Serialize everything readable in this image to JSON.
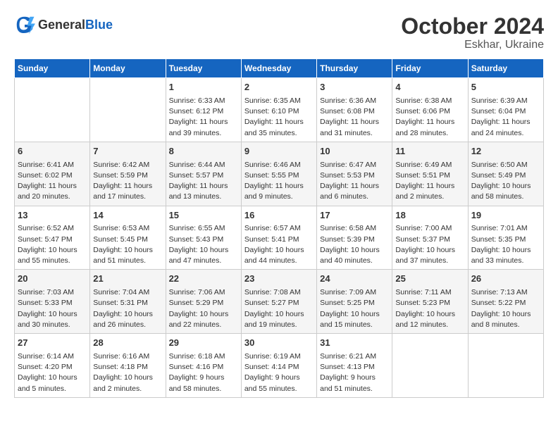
{
  "header": {
    "logo_general": "General",
    "logo_blue": "Blue",
    "month": "October 2024",
    "location": "Eskhar, Ukraine"
  },
  "weekdays": [
    "Sunday",
    "Monday",
    "Tuesday",
    "Wednesday",
    "Thursday",
    "Friday",
    "Saturday"
  ],
  "rows": [
    [
      {
        "day": "",
        "info": ""
      },
      {
        "day": "",
        "info": ""
      },
      {
        "day": "1",
        "info": "Sunrise: 6:33 AM\nSunset: 6:12 PM\nDaylight: 11 hours and 39 minutes."
      },
      {
        "day": "2",
        "info": "Sunrise: 6:35 AM\nSunset: 6:10 PM\nDaylight: 11 hours and 35 minutes."
      },
      {
        "day": "3",
        "info": "Sunrise: 6:36 AM\nSunset: 6:08 PM\nDaylight: 11 hours and 31 minutes."
      },
      {
        "day": "4",
        "info": "Sunrise: 6:38 AM\nSunset: 6:06 PM\nDaylight: 11 hours and 28 minutes."
      },
      {
        "day": "5",
        "info": "Sunrise: 6:39 AM\nSunset: 6:04 PM\nDaylight: 11 hours and 24 minutes."
      }
    ],
    [
      {
        "day": "6",
        "info": "Sunrise: 6:41 AM\nSunset: 6:02 PM\nDaylight: 11 hours and 20 minutes."
      },
      {
        "day": "7",
        "info": "Sunrise: 6:42 AM\nSunset: 5:59 PM\nDaylight: 11 hours and 17 minutes."
      },
      {
        "day": "8",
        "info": "Sunrise: 6:44 AM\nSunset: 5:57 PM\nDaylight: 11 hours and 13 minutes."
      },
      {
        "day": "9",
        "info": "Sunrise: 6:46 AM\nSunset: 5:55 PM\nDaylight: 11 hours and 9 minutes."
      },
      {
        "day": "10",
        "info": "Sunrise: 6:47 AM\nSunset: 5:53 PM\nDaylight: 11 hours and 6 minutes."
      },
      {
        "day": "11",
        "info": "Sunrise: 6:49 AM\nSunset: 5:51 PM\nDaylight: 11 hours and 2 minutes."
      },
      {
        "day": "12",
        "info": "Sunrise: 6:50 AM\nSunset: 5:49 PM\nDaylight: 10 hours and 58 minutes."
      }
    ],
    [
      {
        "day": "13",
        "info": "Sunrise: 6:52 AM\nSunset: 5:47 PM\nDaylight: 10 hours and 55 minutes."
      },
      {
        "day": "14",
        "info": "Sunrise: 6:53 AM\nSunset: 5:45 PM\nDaylight: 10 hours and 51 minutes."
      },
      {
        "day": "15",
        "info": "Sunrise: 6:55 AM\nSunset: 5:43 PM\nDaylight: 10 hours and 47 minutes."
      },
      {
        "day": "16",
        "info": "Sunrise: 6:57 AM\nSunset: 5:41 PM\nDaylight: 10 hours and 44 minutes."
      },
      {
        "day": "17",
        "info": "Sunrise: 6:58 AM\nSunset: 5:39 PM\nDaylight: 10 hours and 40 minutes."
      },
      {
        "day": "18",
        "info": "Sunrise: 7:00 AM\nSunset: 5:37 PM\nDaylight: 10 hours and 37 minutes."
      },
      {
        "day": "19",
        "info": "Sunrise: 7:01 AM\nSunset: 5:35 PM\nDaylight: 10 hours and 33 minutes."
      }
    ],
    [
      {
        "day": "20",
        "info": "Sunrise: 7:03 AM\nSunset: 5:33 PM\nDaylight: 10 hours and 30 minutes."
      },
      {
        "day": "21",
        "info": "Sunrise: 7:04 AM\nSunset: 5:31 PM\nDaylight: 10 hours and 26 minutes."
      },
      {
        "day": "22",
        "info": "Sunrise: 7:06 AM\nSunset: 5:29 PM\nDaylight: 10 hours and 22 minutes."
      },
      {
        "day": "23",
        "info": "Sunrise: 7:08 AM\nSunset: 5:27 PM\nDaylight: 10 hours and 19 minutes."
      },
      {
        "day": "24",
        "info": "Sunrise: 7:09 AM\nSunset: 5:25 PM\nDaylight: 10 hours and 15 minutes."
      },
      {
        "day": "25",
        "info": "Sunrise: 7:11 AM\nSunset: 5:23 PM\nDaylight: 10 hours and 12 minutes."
      },
      {
        "day": "26",
        "info": "Sunrise: 7:13 AM\nSunset: 5:22 PM\nDaylight: 10 hours and 8 minutes."
      }
    ],
    [
      {
        "day": "27",
        "info": "Sunrise: 6:14 AM\nSunset: 4:20 PM\nDaylight: 10 hours and 5 minutes."
      },
      {
        "day": "28",
        "info": "Sunrise: 6:16 AM\nSunset: 4:18 PM\nDaylight: 10 hours and 2 minutes."
      },
      {
        "day": "29",
        "info": "Sunrise: 6:18 AM\nSunset: 4:16 PM\nDaylight: 9 hours and 58 minutes."
      },
      {
        "day": "30",
        "info": "Sunrise: 6:19 AM\nSunset: 4:14 PM\nDaylight: 9 hours and 55 minutes."
      },
      {
        "day": "31",
        "info": "Sunrise: 6:21 AM\nSunset: 4:13 PM\nDaylight: 9 hours and 51 minutes."
      },
      {
        "day": "",
        "info": ""
      },
      {
        "day": "",
        "info": ""
      }
    ]
  ]
}
